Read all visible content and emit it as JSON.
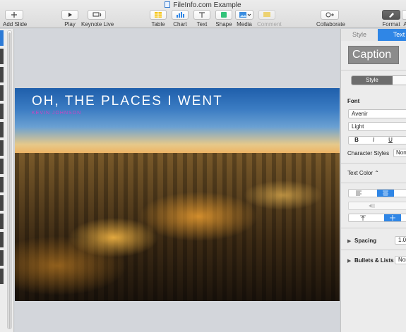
{
  "window": {
    "title": "FileInfo.com Example"
  },
  "toolbar": {
    "add_slide": "Add Slide",
    "play": "Play",
    "keynote_live": "Keynote Live",
    "table": "Table",
    "chart": "Chart",
    "text": "Text",
    "shape": "Shape",
    "media": "Media",
    "comment": "Comment",
    "collaborate": "Collaborate",
    "format": "Format",
    "animate_partial": "A"
  },
  "slide": {
    "title": "OH, THE PLACES I WENT",
    "subtitle": "KEVIN JOHNSON"
  },
  "inspector": {
    "tabs": {
      "style": "Style",
      "text": "Text"
    },
    "paragraph_style": "Caption",
    "segment_selected": "Style",
    "font_label": "Font",
    "font_family": "Avenir",
    "font_weight": "Light",
    "bius": {
      "bold": "B",
      "italic": "I",
      "underline": "U"
    },
    "character_styles_label": "Character Styles",
    "character_styles_value": "None",
    "text_color_label": "Text Color",
    "text_color_chevron": "⌃",
    "spacing_label": "Spacing",
    "spacing_value": "1.0",
    "bullets_label": "Bullets & Lists",
    "bullets_value": "None",
    "disclosure": "▶"
  },
  "colors": {
    "accent": "#2f86e6",
    "subtitle": "#d043c4"
  }
}
